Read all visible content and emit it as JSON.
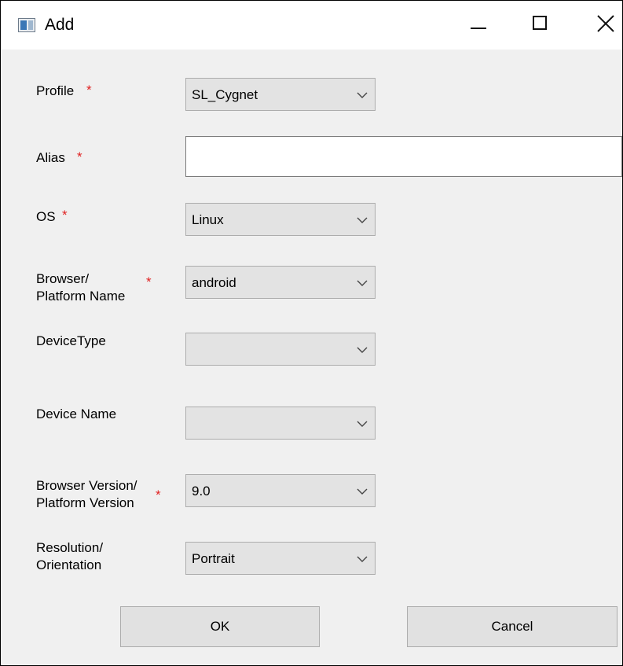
{
  "window": {
    "title": "Add",
    "controls": {
      "minimize": "minimize",
      "maximize": "maximize",
      "close": "close"
    }
  },
  "fields": {
    "profile": {
      "label": "Profile",
      "required": "*",
      "value": "SL_Cygnet"
    },
    "alias": {
      "label": "Alias",
      "required": "*",
      "value": ""
    },
    "os": {
      "label": "OS",
      "required": "*",
      "value": "Linux"
    },
    "browser": {
      "label_line1": "Browser/",
      "label_line2": "Platform Name",
      "required": "*",
      "value": "android"
    },
    "device_type": {
      "label": "DeviceType",
      "value": ""
    },
    "device_name": {
      "label": "Device Name",
      "value": ""
    },
    "browser_version": {
      "label_line1": "Browser Version/",
      "label_line2": "Platform Version",
      "required": "*",
      "value": "9.0"
    },
    "resolution": {
      "label_line1": "Resolution/",
      "label_line2": "Orientation",
      "value": "Portrait"
    }
  },
  "buttons": {
    "ok": "OK",
    "cancel": "Cancel"
  },
  "colors": {
    "required_marker": "#e02020",
    "dialog_background": "#f0f0f0",
    "combo_background": "#e3e3e3"
  }
}
